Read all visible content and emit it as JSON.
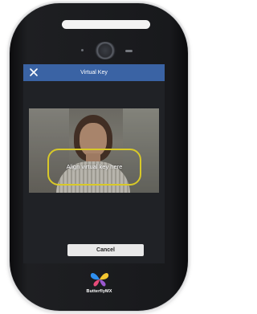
{
  "screen": {
    "title": "Virtual Key",
    "close_icon": "close-icon",
    "align_label": "Align virtual key here",
    "cancel_label": "Cancel"
  },
  "brand": {
    "name": "ButterflyMX",
    "logo_icon": "butterfly-logo-icon"
  },
  "colors": {
    "title_bar": "#3a63a4",
    "frame": "#d8c928"
  }
}
